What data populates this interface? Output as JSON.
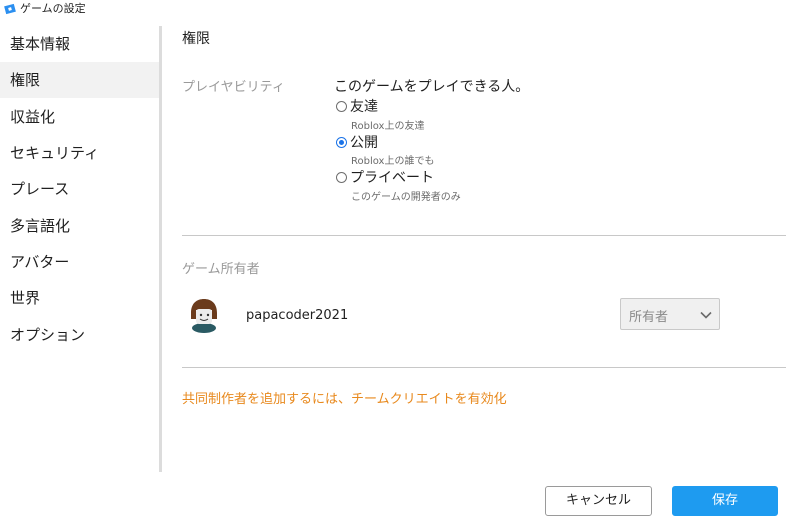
{
  "window": {
    "title": "ゲームの設定",
    "icon": "roblox-studio-icon"
  },
  "sidebar": {
    "items": [
      {
        "label": "基本情報",
        "active": false
      },
      {
        "label": "権限",
        "active": true
      },
      {
        "label": "収益化",
        "active": false
      },
      {
        "label": "セキュリティ",
        "active": false
      },
      {
        "label": "プレース",
        "active": false
      },
      {
        "label": "多言語化",
        "active": false
      },
      {
        "label": "アバター",
        "active": false
      },
      {
        "label": "世界",
        "active": false
      },
      {
        "label": "オプション",
        "active": false
      }
    ]
  },
  "main": {
    "title": "権限",
    "playability": {
      "label": "プレイヤビリティ",
      "question": "このゲームをプレイできる人。",
      "options": [
        {
          "label": "友達",
          "description": "Roblox上の友達",
          "selected": false
        },
        {
          "label": "公開",
          "description": "Roblox上の誰でも",
          "selected": true
        },
        {
          "label": "プライベート",
          "description": "このゲームの開発者のみ",
          "selected": false
        }
      ]
    },
    "owner": {
      "label": "ゲーム所有者",
      "username": "papacoder2021",
      "role": "所有者"
    },
    "enable_team_create": "共同制作者を追加するには、チームクリエイトを有効化"
  },
  "footer": {
    "cancel_label": "キャンセル",
    "save_label": "保存"
  },
  "colors": {
    "accent": "#1e9bf0",
    "radio_selected": "#1a73e8",
    "link_orange": "#e8891d",
    "muted_text": "#9a9a9a"
  }
}
